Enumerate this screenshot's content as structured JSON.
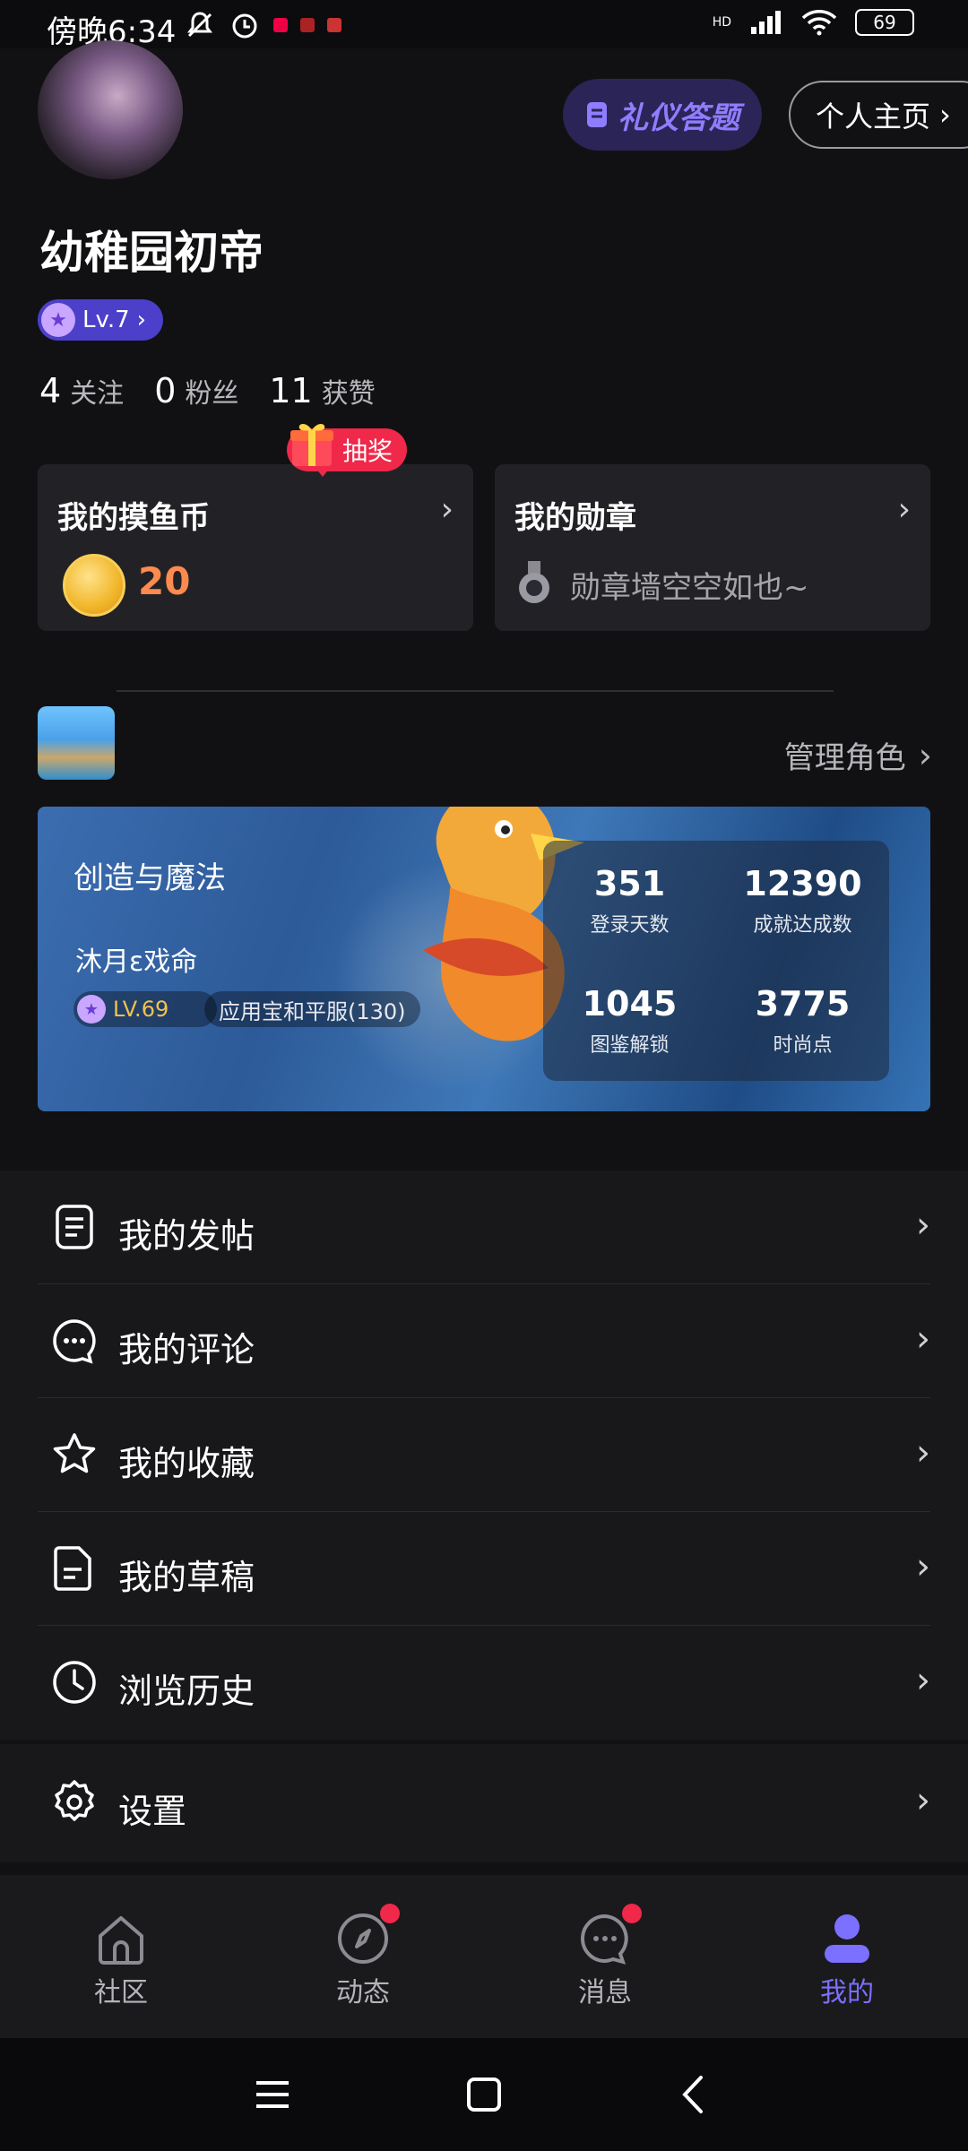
{
  "status_bar": {
    "time": "傍晚6:34",
    "battery": "69",
    "network": "HD"
  },
  "header": {
    "quiz_button": "礼仪答题",
    "homepage_button": "个人主页"
  },
  "profile": {
    "username": "幼稚园初帝",
    "level": "Lv.7",
    "stats": [
      {
        "num": "4",
        "label": "关注"
      },
      {
        "num": "0",
        "label": "粉丝"
      },
      {
        "num": "11",
        "label": "获赞"
      }
    ]
  },
  "lottery_tag": "抽奖",
  "coin_card": {
    "title": "我的摸鱼币",
    "value": "20"
  },
  "medal_card": {
    "title": "我的勋章",
    "empty_text": "勋章墙空空如也~"
  },
  "game": {
    "manage_label": "管理角色",
    "name": "创造与魔法",
    "role_name": "沐月ε戏命",
    "role_level": "LV.69",
    "server": "应用宝和平服(130)",
    "stats": [
      {
        "value": "351",
        "label": "登录天数"
      },
      {
        "value": "12390",
        "label": "成就达成数"
      },
      {
        "value": "1045",
        "label": "图鉴解锁"
      },
      {
        "value": "3775",
        "label": "时尚点"
      }
    ]
  },
  "menu": [
    {
      "label": "我的发帖",
      "icon": "document-icon"
    },
    {
      "label": "我的评论",
      "icon": "comment-icon"
    },
    {
      "label": "我的收藏",
      "icon": "star-icon"
    },
    {
      "label": "我的草稿",
      "icon": "draft-icon"
    },
    {
      "label": "浏览历史",
      "icon": "clock-icon"
    }
  ],
  "settings_label": "设置",
  "bottom_nav": [
    {
      "label": "社区",
      "icon": "home-icon",
      "badge": false,
      "active": false
    },
    {
      "label": "动态",
      "icon": "compass-icon",
      "badge": true,
      "active": false
    },
    {
      "label": "消息",
      "icon": "message-icon",
      "badge": true,
      "active": false
    },
    {
      "label": "我的",
      "icon": "user-icon",
      "badge": false,
      "active": true
    }
  ],
  "colors": {
    "accent": "#7b70ff",
    "coin": "#ff8a50",
    "badge": "#f0284a",
    "background": "#111113"
  }
}
